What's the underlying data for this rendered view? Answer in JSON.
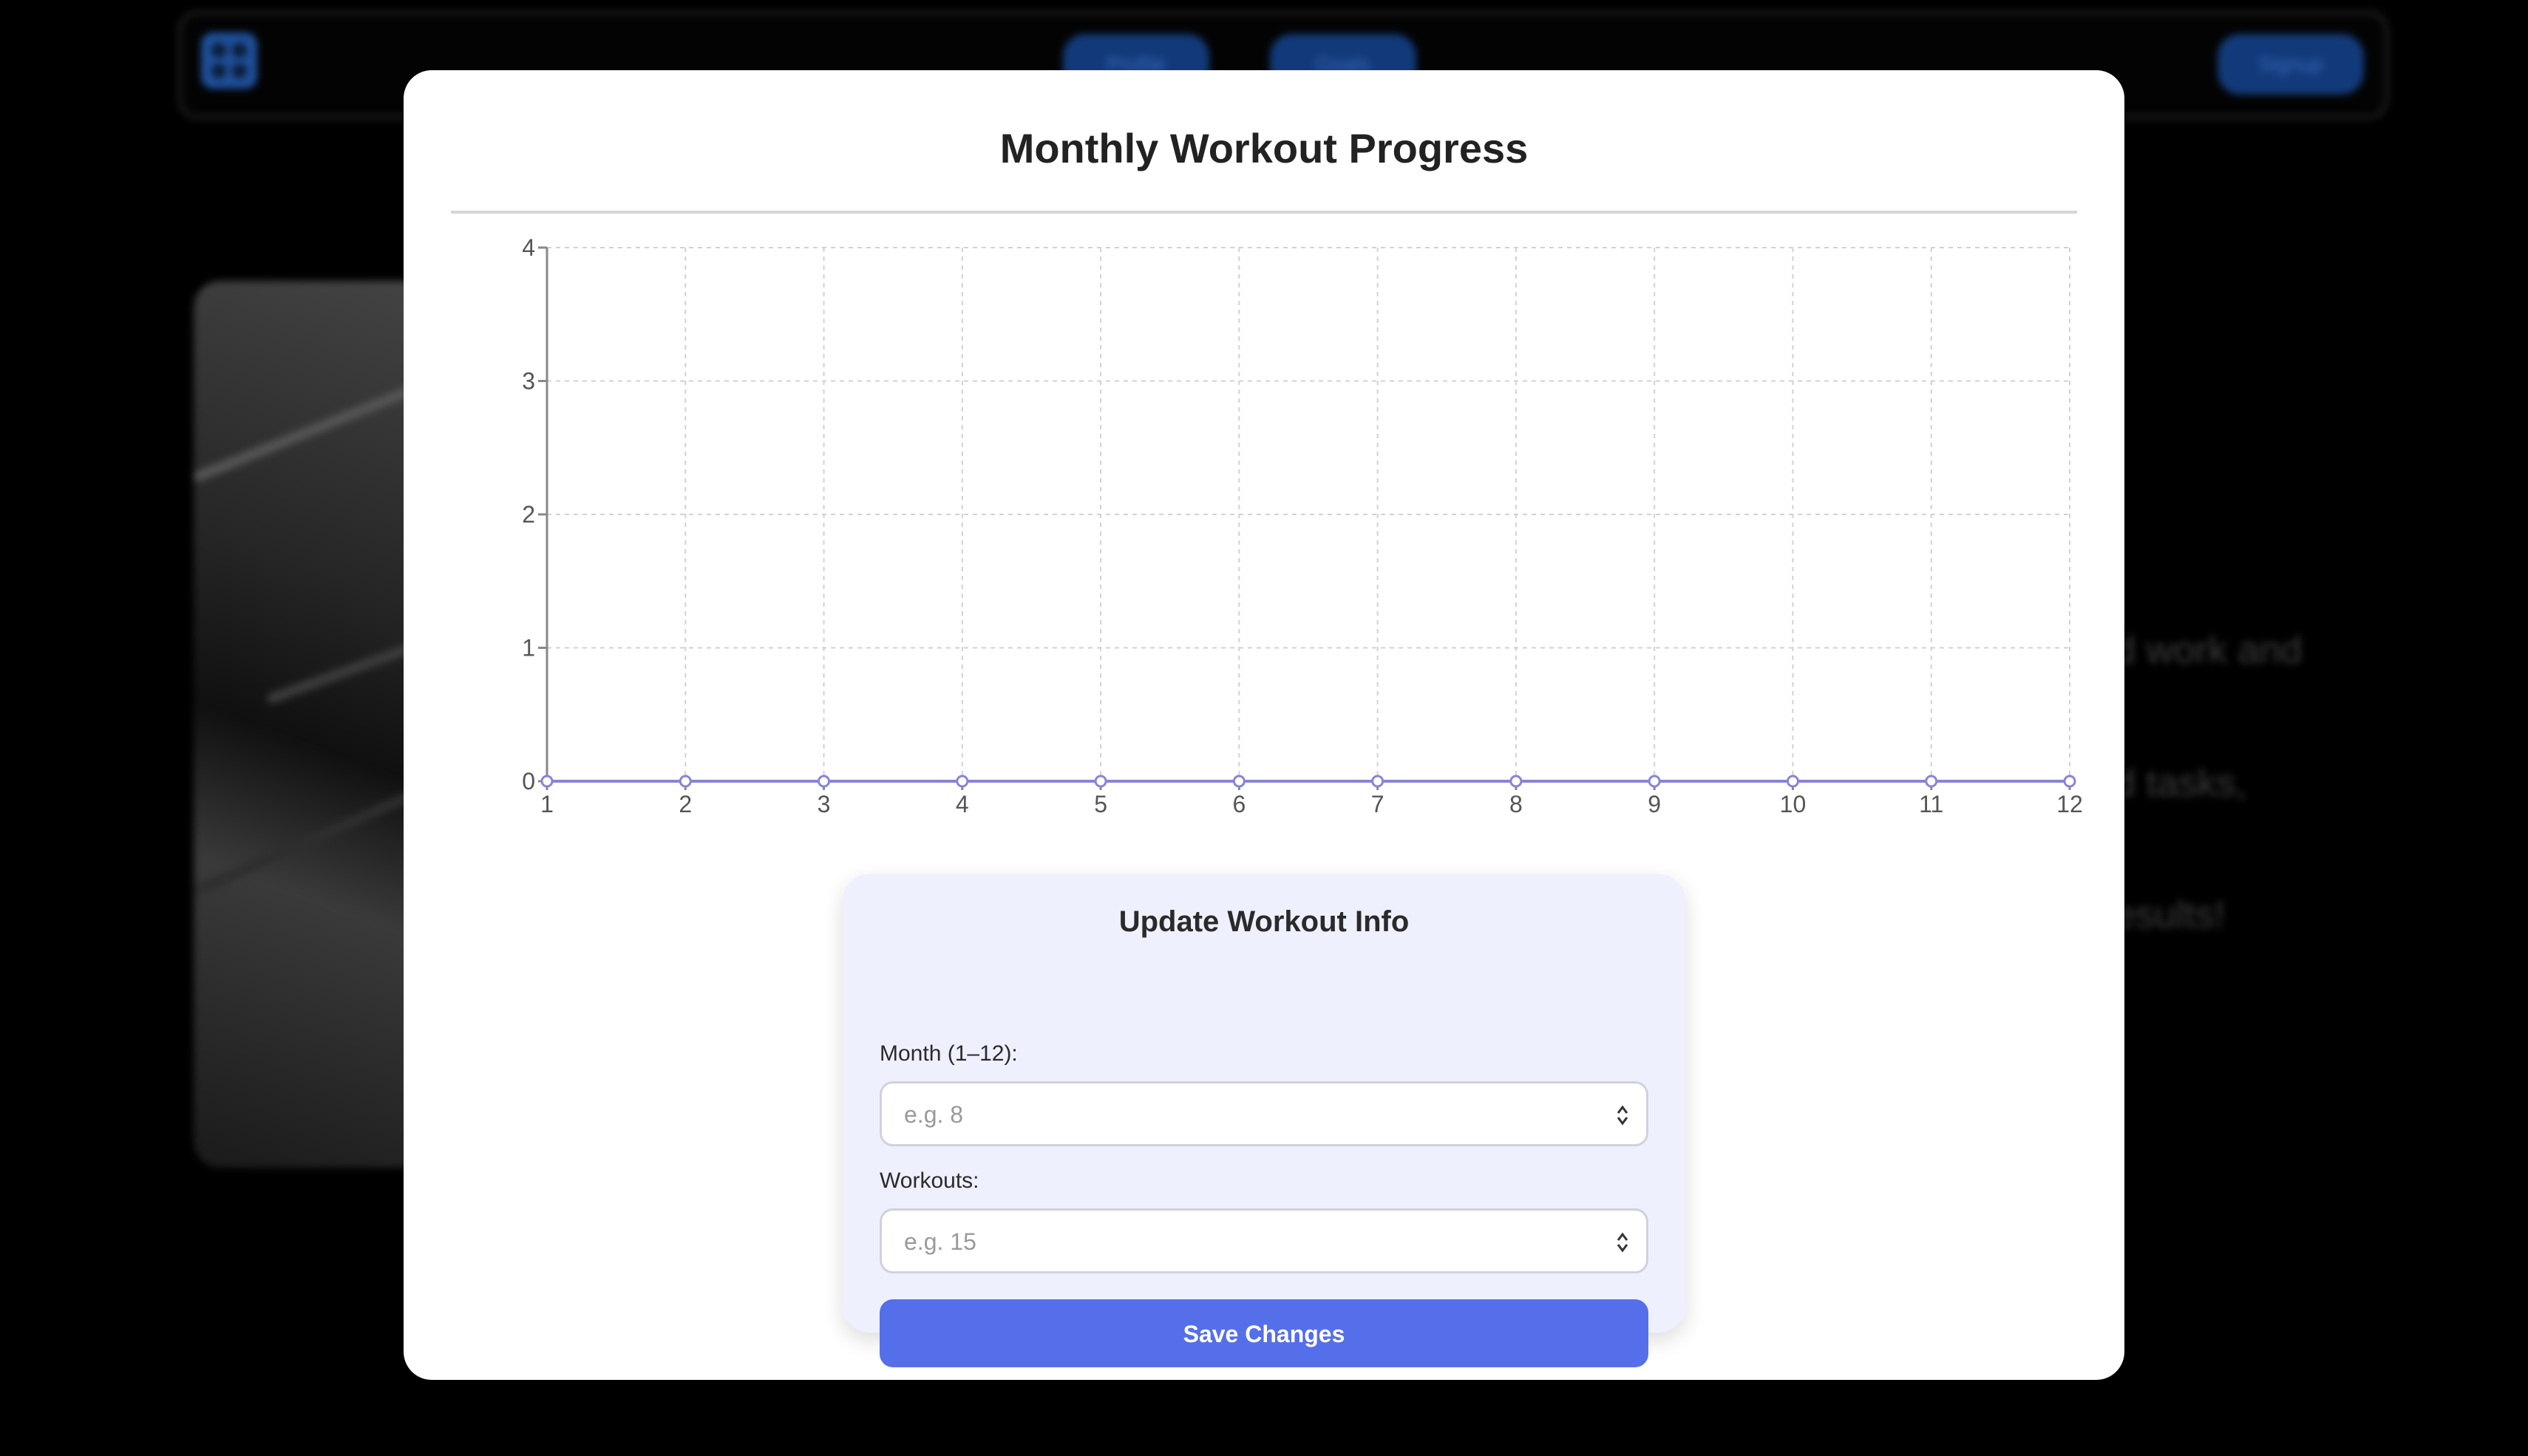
{
  "background": {
    "nav_buttons": [
      "Profile",
      "Goals"
    ],
    "nav_action": "Signup",
    "text_lines": [
      "d work and",
      "d tasks,",
      "esults!"
    ]
  },
  "modal": {
    "title": "Monthly Workout Progress"
  },
  "chart_data": {
    "type": "line",
    "title": "",
    "xlabel": "",
    "ylabel": "",
    "x": [
      1,
      2,
      3,
      4,
      5,
      6,
      7,
      8,
      9,
      10,
      11,
      12
    ],
    "series": [
      {
        "values": [
          0,
          0,
          0,
          0,
          0,
          0,
          0,
          0,
          0,
          0,
          0,
          0
        ]
      }
    ],
    "xlim": [
      1,
      12
    ],
    "ylim": [
      0,
      4
    ],
    "yticks": [
      0,
      1,
      2,
      3,
      4
    ],
    "grid": true,
    "line_color": "#8884d8"
  },
  "form": {
    "title": "Update Workout Info",
    "month_label": "Month (1–12):",
    "month_placeholder": "e.g. 8",
    "workouts_label": "Workouts:",
    "workouts_placeholder": "e.g. 15",
    "save_label": "Save Changes"
  },
  "colors": {
    "accent": "#556fea",
    "card_bg": "#eef0fd"
  }
}
